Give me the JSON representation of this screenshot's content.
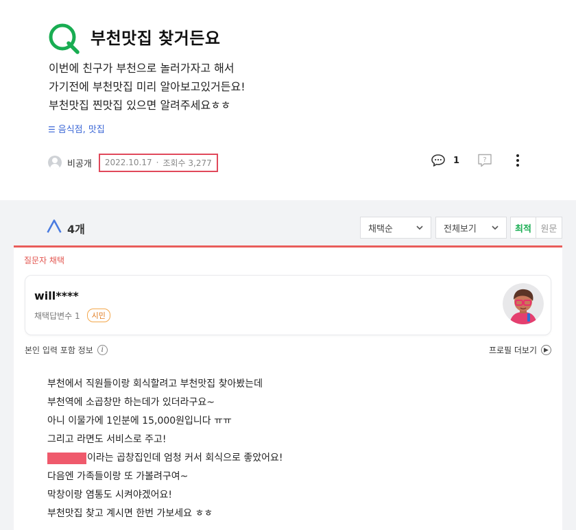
{
  "question": {
    "title": "부천맛집 찾거든요",
    "body_lines": [
      "이번에 친구가 부천으로 놀러가자고 해서",
      "가기전에 부천맛집 미리 알아보고있거든요!",
      "부천맛집 찐맛집 있으면 알려주세요ㅎㅎ"
    ],
    "category": "음식점, 맛집",
    "author": "비공개",
    "date": "2022.10.17",
    "views": "조회수 3,277",
    "comment_count": "1"
  },
  "answers": {
    "count": "4개",
    "sort_selected": "채택순",
    "view_selected": "전체보기",
    "tabs": [
      "최적",
      "원문"
    ],
    "chosen_label": "질문자 채택",
    "answerer": {
      "name": "will****",
      "stat": "채택답변수 1",
      "badge": "시민"
    },
    "info_label": "본인 입력 포함 정보",
    "profile_more": "프로필 더보기",
    "body_lines": [
      "부천에서 직원들이랑 회식할려고 부천맛집 찾아봤는데",
      "부천역에 소곱창만 하는데가 있더라구요~",
      "아니 이물가에 1인분에 15,000원입니다 ㅠㅠ",
      "그리고 라면도 서비스로 주고!",
      "이라는 곱창집인데 엄청 커서 회식으로 좋았어요!",
      "다음엔 가족들이랑 또 가볼려구여~",
      "막창이랑 염통도 시켜야겠어요!",
      "부천맛집 찾고 계시면 한번 가보세요 ㅎㅎ"
    ]
  },
  "colors": {
    "brand_green": "#19ad52",
    "highlight_red": "#e0485a",
    "chosen_red": "#e95d5a",
    "link_blue": "#3a66d6"
  },
  "icons": [
    "q-mark-icon",
    "a-mark-icon",
    "comment-icon",
    "report-icon",
    "more-vertical-icon",
    "chevron-down-icon",
    "info-icon",
    "arrow-right-circle-icon",
    "category-list-icon"
  ]
}
